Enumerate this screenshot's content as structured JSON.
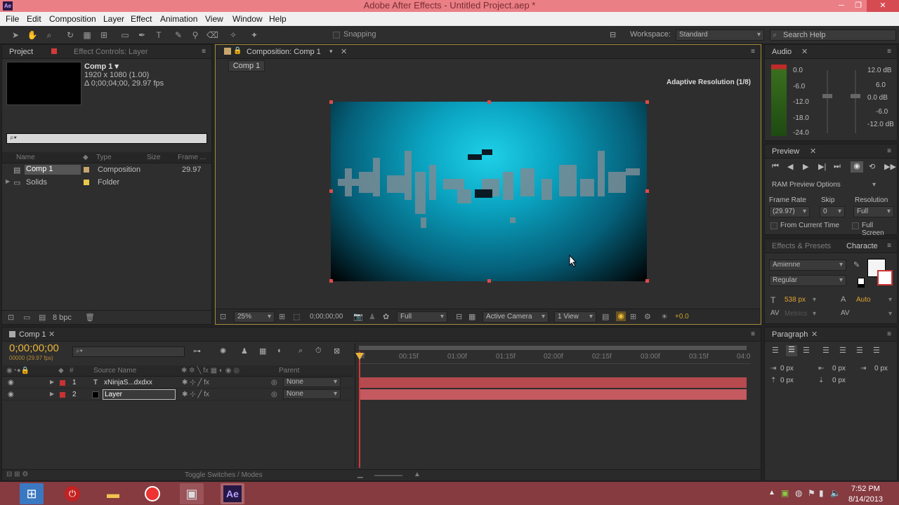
{
  "window": {
    "title": "Adobe After Effects - Untitled Project.aep *",
    "app_icon": "Ae"
  },
  "menu": [
    "File",
    "Edit",
    "Composition",
    "Layer",
    "Effect",
    "Animation",
    "View",
    "Window",
    "Help"
  ],
  "toolbar": {
    "snapping": "Snapping",
    "workspace_label": "Workspace:",
    "workspace_value": "Standard",
    "search_placeholder": "Search Help"
  },
  "project": {
    "tab": "Project",
    "effect_controls_tab": "Effect Controls: Layer",
    "thumb_name": "Comp 1 ▾",
    "thumb_res": "1920 x 1080 (1.00)",
    "thumb_dur": "Δ 0;00;04;00, 29.97 fps",
    "search": "⌕▾",
    "columns": [
      "Name",
      "Type",
      "Size",
      "Frame ..."
    ],
    "items": [
      {
        "name": "Comp 1",
        "type": "Composition",
        "fps": "29.97",
        "color": "#c9a66b"
      },
      {
        "name": "Solids",
        "type": "Folder",
        "fps": "",
        "color": "#e8c84a"
      }
    ],
    "bpc": "8 bpc"
  },
  "composition": {
    "tab": "Composition: Comp 1",
    "subtab": "Comp 1",
    "adaptive": "Adaptive Resolution (1/8)",
    "zoom": "25%",
    "timecode": "0;00;00;00",
    "quality": "Full",
    "camera": "Active Camera",
    "views": "1 View",
    "exposure": "+0.0"
  },
  "audio": {
    "tab": "Audio",
    "left_levels": [
      "0.0",
      "-6.0",
      "-12.0",
      "-18.0",
      "-24.0"
    ],
    "right_levels": [
      "12.0 dB",
      "6.0",
      "0.0 dB",
      "-6.0",
      "-12.0 dB"
    ]
  },
  "preview": {
    "tab": "Preview",
    "ram_options": "RAM Preview Options",
    "frame_rate_label": "Frame Rate",
    "skip_label": "Skip",
    "resolution_label": "Resolution",
    "frame_rate": "(29.97)",
    "skip": "0",
    "resolution": "Full",
    "from_current": "From Current Time",
    "full_screen": "Full Screen"
  },
  "effects_tab": "Effects & Presets",
  "character": {
    "tab": "Characte",
    "font": "Amienne",
    "style": "Regular",
    "size": "538 px",
    "leading": "Auto",
    "kerning": "Metrics"
  },
  "paragraph": {
    "tab": "Paragraph",
    "indent_values": [
      "0 px",
      "0 px",
      "0 px",
      "0 px",
      "0 px"
    ]
  },
  "timeline": {
    "tab": "Comp 1",
    "timecode": "0;00;00;00",
    "fps_note": "00000 (29.97 fps)",
    "source_header": "Source Name",
    "parent_header": "Parent",
    "ruler": [
      "0f",
      "00:15f",
      "01:00f",
      "01:15f",
      "02:00f",
      "02:15f",
      "03:00f",
      "03:15f",
      "04:0"
    ],
    "layers": [
      {
        "num": "1",
        "name": "xNinjaS...dxdxx",
        "parent": "None",
        "color": "#c83232"
      },
      {
        "num": "2",
        "name": "Layer",
        "parent": "None",
        "color": "#c83232"
      }
    ],
    "toggle": "Toggle Switches / Modes"
  },
  "taskbar": {
    "time": "7:52 PM",
    "date": "8/14/2013",
    "ae_label": "Ae"
  }
}
